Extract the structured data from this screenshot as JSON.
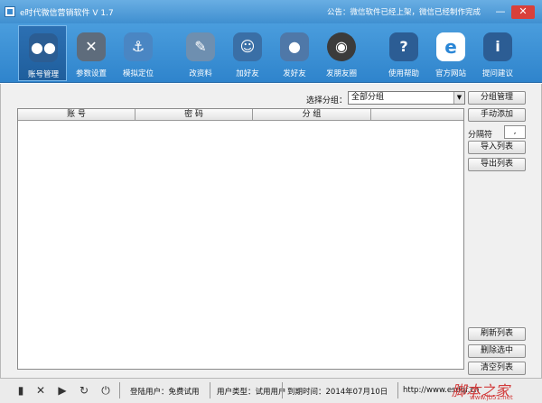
{
  "window": {
    "title": "e时代微信营销软件  V 1.7",
    "notice": "公告：微信软件已经上架，微信已经制作完成",
    "min_label": "—",
    "close_label": "✕"
  },
  "toolbar": {
    "items": [
      {
        "label": "账号管理",
        "icon": "users-icon",
        "glyph": "●",
        "color": "#2b5d93"
      },
      {
        "label": "参数设置",
        "icon": "tools-icon",
        "glyph": "✕",
        "color": "#5e6c7c"
      },
      {
        "label": "模拟定位",
        "icon": "anchor-icon",
        "glyph": "⚓",
        "color": "#4a86c3"
      },
      {
        "label": "改资料",
        "icon": "edit-note-icon",
        "glyph": "✎",
        "color": "#6e8fb0"
      },
      {
        "label": "加好友",
        "icon": "person-icon",
        "glyph": "☺",
        "color": "#3a6fa6"
      },
      {
        "label": "发好友",
        "icon": "chat-icon",
        "glyph": "●",
        "color": "#4f78a8"
      },
      {
        "label": "发朋友圈",
        "icon": "camera-icon",
        "glyph": "◉",
        "color": "#3b3b3b"
      },
      {
        "label": "使用帮助",
        "icon": "help-icon",
        "glyph": "?",
        "color": "#2c5d94"
      },
      {
        "label": "官方网站",
        "icon": "browser-icon",
        "glyph": "e",
        "color": "#2a86d6"
      },
      {
        "label": "提问建议",
        "icon": "info-icon",
        "glyph": "i",
        "color": "#2c5d94"
      }
    ]
  },
  "main": {
    "group_label": "选择分组：",
    "group_selected": "全部分组",
    "columns": [
      "账  号",
      "密  码",
      "分  组"
    ]
  },
  "buttons": {
    "group_manage": "分组管理",
    "manual_add": "手动添加",
    "separator_label": "分隔符",
    "separator_value": ",",
    "import_list": "导入列表",
    "export_list": "导出列表",
    "refresh_list": "刷新列表",
    "delete_selected": "删除选中",
    "clear_list": "清空列表"
  },
  "status": {
    "login_user": "登陆用户：免费试用",
    "user_type": "用户类型：试用用户",
    "expire": "到期时间：2014年07月10日",
    "url": "http://www.esdqf.cn",
    "watermark": "脚本之家",
    "watermark_url": "www.jb51.net"
  }
}
